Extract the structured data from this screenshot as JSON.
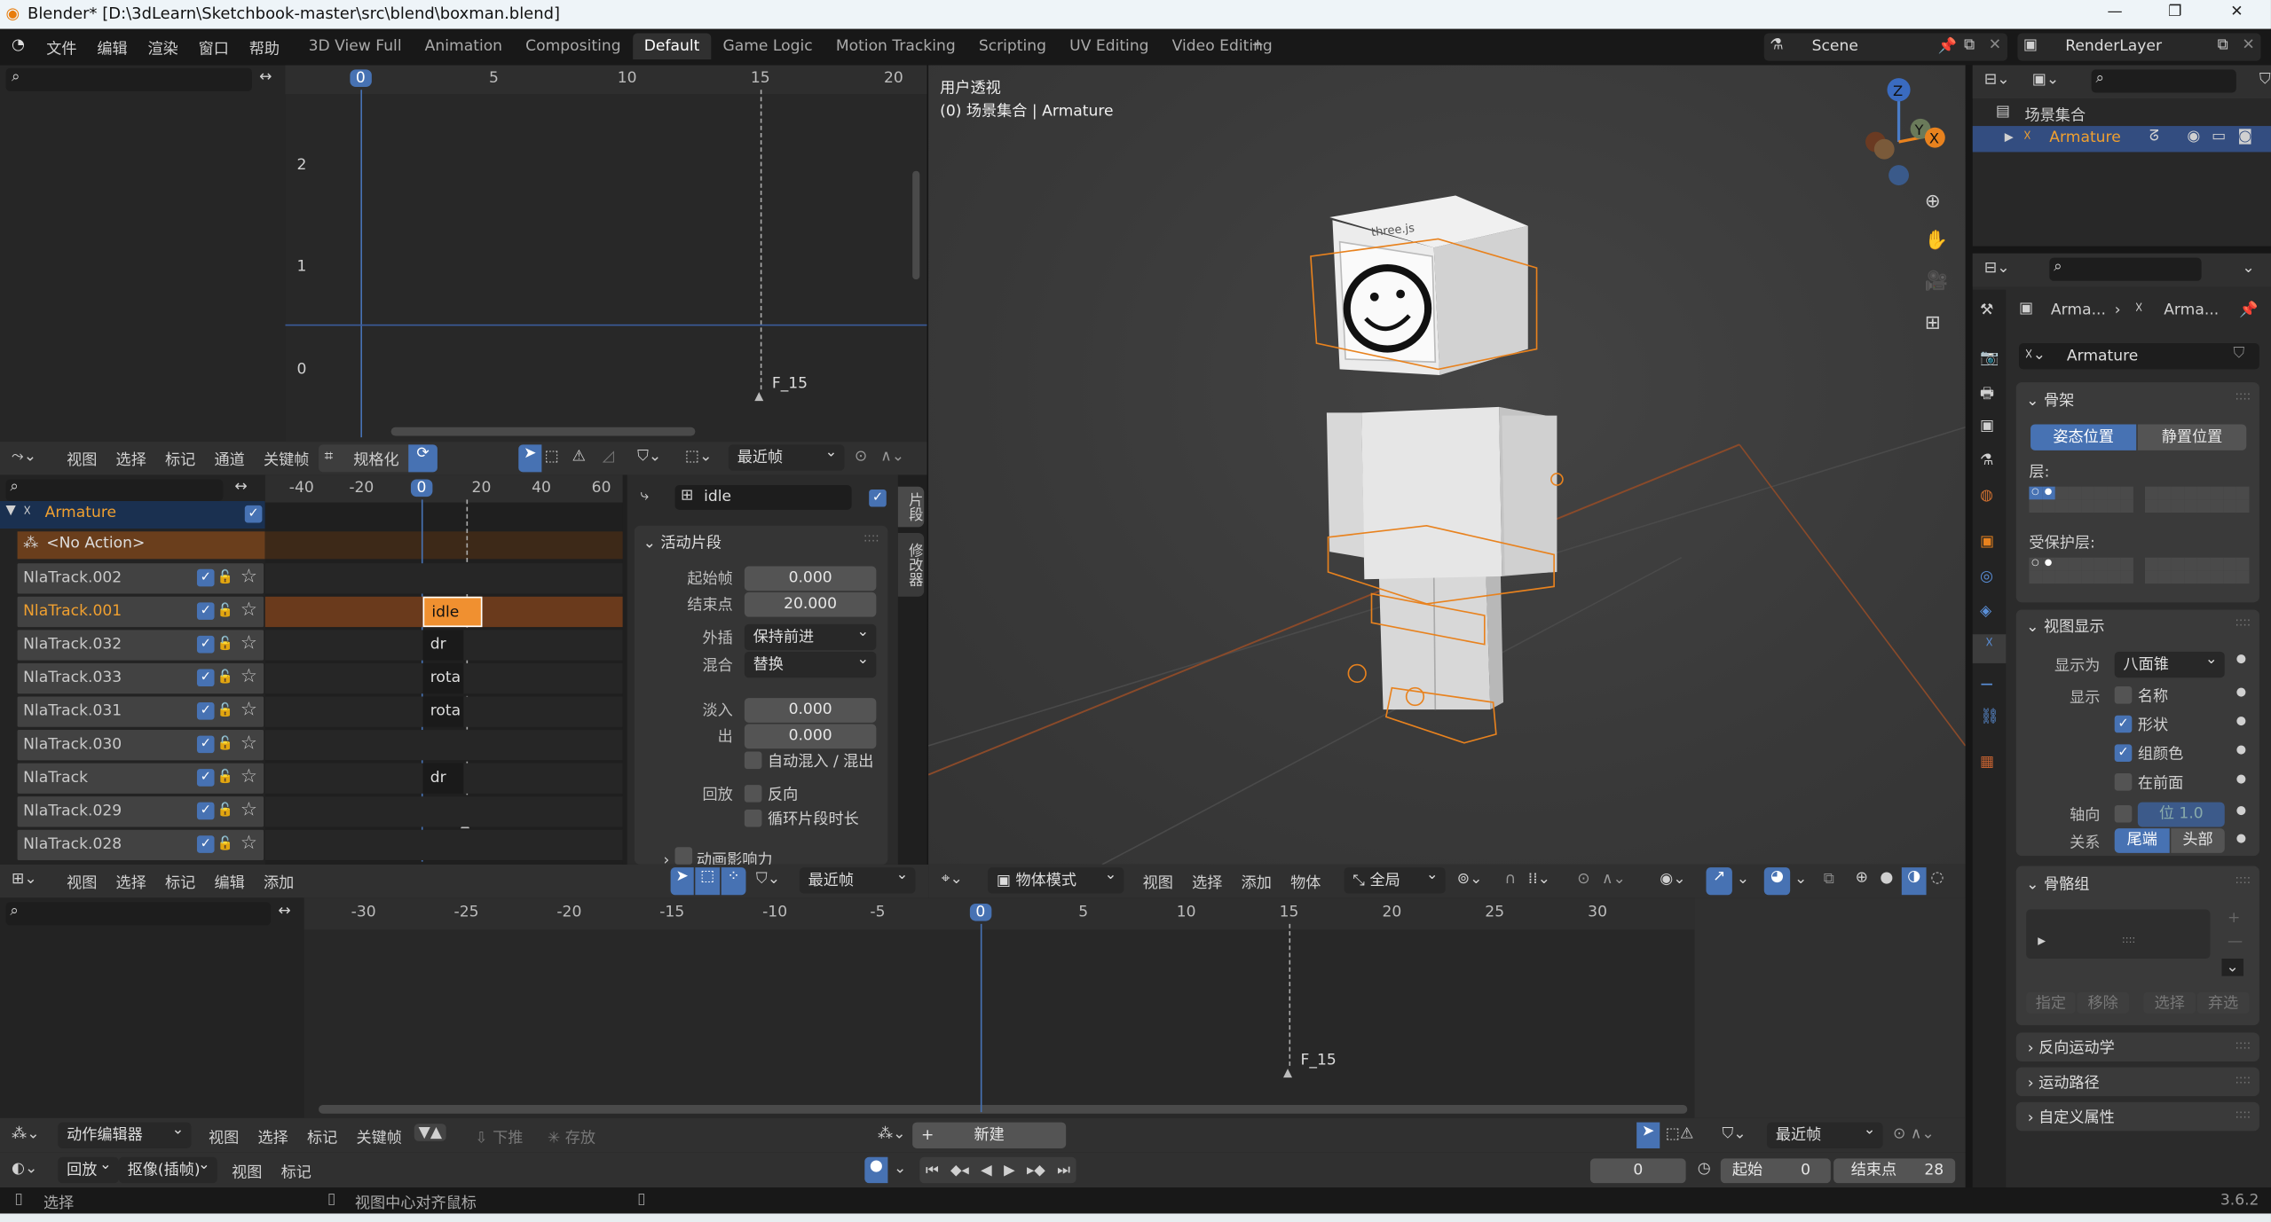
{
  "window": {
    "title": "Blender* [D:\\3dLearn\\Sketchbook-master\\src\\blend\\boxman.blend]",
    "minimize": "—",
    "maximize": "❐",
    "close": "✕"
  },
  "menubar": {
    "items": [
      "文件",
      "编辑",
      "渲染",
      "窗口",
      "帮助"
    ],
    "workspaces": [
      "3D View Full",
      "Animation",
      "Compositing",
      "Default",
      "Game Logic",
      "Motion Tracking",
      "Scripting",
      "UV Editing",
      "Video Editing"
    ],
    "active_workspace": "Default",
    "add_tab": "+",
    "scene": "Scene",
    "render_layer": "RenderLayer"
  },
  "graph": {
    "ruler": [
      0,
      5,
      10,
      15,
      20
    ],
    "current_frame": "0",
    "y_labels": [
      "2",
      "1",
      "0"
    ],
    "marker": "F_15"
  },
  "nla_header": {
    "items": [
      "视图",
      "选择",
      "标记",
      "通道",
      "关键帧"
    ],
    "normalize": "规格化",
    "snap": "最近帧"
  },
  "nla": {
    "ruler": [
      -40,
      -20,
      20,
      40,
      60
    ],
    "current_frame": "0",
    "marker": "F_15",
    "object": "Armature",
    "no_action": "<No Action>",
    "tracks": [
      "NlaTrack.002",
      "NlaTrack.001",
      "NlaTrack.032",
      "NlaTrack.033",
      "NlaTrack.031",
      "NlaTrack.030",
      "NlaTrack",
      "NlaTrack.029",
      "NlaTrack.028"
    ],
    "active_track": "NlaTrack.001",
    "strips": [
      {
        "track": 1,
        "label": "idle",
        "active": true
      },
      {
        "track": 2,
        "label": "dr"
      },
      {
        "track": 3,
        "label": "rota"
      },
      {
        "track": 4,
        "label": "rota"
      },
      {
        "track": 6,
        "label": "dr"
      }
    ]
  },
  "nla_sidebar": {
    "strip_name": "idle",
    "panel": "活动片段",
    "start_label": "起始帧",
    "start": "0.000",
    "end_label": "结束点",
    "end": "20.000",
    "extrap_label": "外插",
    "extrap": "保持前进",
    "blend_label": "混合",
    "blend": "替换",
    "fadein_label": "淡入",
    "fadein": "0.000",
    "fadeout_label": "出",
    "fadeout": "0.000",
    "auto_blend": "自动混入 / 混出",
    "playback_label": "回放",
    "reverse": "反向",
    "cyclic": "循环片段时长",
    "influence": "动画影响力",
    "tabs": [
      "片段",
      "修改器"
    ]
  },
  "dope_header": {
    "items": [
      "视图",
      "选择",
      "标记",
      "编辑",
      "添加"
    ],
    "snap": "最近帧"
  },
  "viewport": {
    "overlay_title": "用户透视",
    "overlay_sub": "(0) 场景集合 | Armature",
    "head_logo": "three.js",
    "header": {
      "mode": "物体模式",
      "items": [
        "视图",
        "选择",
        "添加",
        "物体"
      ],
      "orientation": "全局"
    },
    "gizmo": {
      "z": "Z",
      "y": "Y",
      "x": "X"
    }
  },
  "dopesheet": {
    "ruler": [
      -30,
      -25,
      -20,
      -15,
      -10,
      -5,
      5,
      10,
      15,
      20,
      25,
      30
    ],
    "current_frame": "0",
    "marker": "F_15"
  },
  "action_header": {
    "mode": "动作编辑器",
    "items": [
      "视图",
      "选择",
      "标记",
      "关键帧"
    ],
    "push_down": "下推",
    "stash": "存放",
    "new": "新建",
    "snap": "最近帧"
  },
  "timeline": {
    "playback": "回放",
    "keying": "抠像(插帧)",
    "items": [
      "视图",
      "标记"
    ],
    "current": "0",
    "start_label": "起始",
    "start": "0",
    "end_label": "结束点",
    "end": "28"
  },
  "status": {
    "select": "选择",
    "center": "视图中心对齐鼠标",
    "version": "3.6.2"
  },
  "outliner": {
    "collection": "场景集合",
    "object": "Armature"
  },
  "properties": {
    "breadcrumb": [
      "Arma...",
      "Arma..."
    ],
    "datablock": "Armature",
    "skeleton": {
      "title": "骨架",
      "pose": "姿态位置",
      "rest": "静置位置",
      "layers": "层:",
      "protected": "受保护层:"
    },
    "display": {
      "title": "视图显示",
      "display_as_label": "显示为",
      "display_as": "八面锥",
      "show_label": "显示",
      "options": [
        {
          "label": "名称",
          "checked": false
        },
        {
          "label": "形状",
          "checked": true
        },
        {
          "label": "组颜色",
          "checked": true
        },
        {
          "label": "在前面",
          "checked": false
        }
      ],
      "axes_label": "轴向",
      "axes_value": "位  1.0",
      "relation_label": "关系",
      "tail": "尾端",
      "head": "头部"
    },
    "bone_groups": {
      "title": "骨骼组",
      "assign": "指定",
      "remove": "移除",
      "select": "选择",
      "deselect": "弃选"
    },
    "collapsed": [
      "反向运动学",
      "运动路径",
      "自定义属性"
    ]
  },
  "colors": {
    "accent": "#4772b3",
    "active_orange": "#f0a030",
    "selection": "#e8821e"
  }
}
